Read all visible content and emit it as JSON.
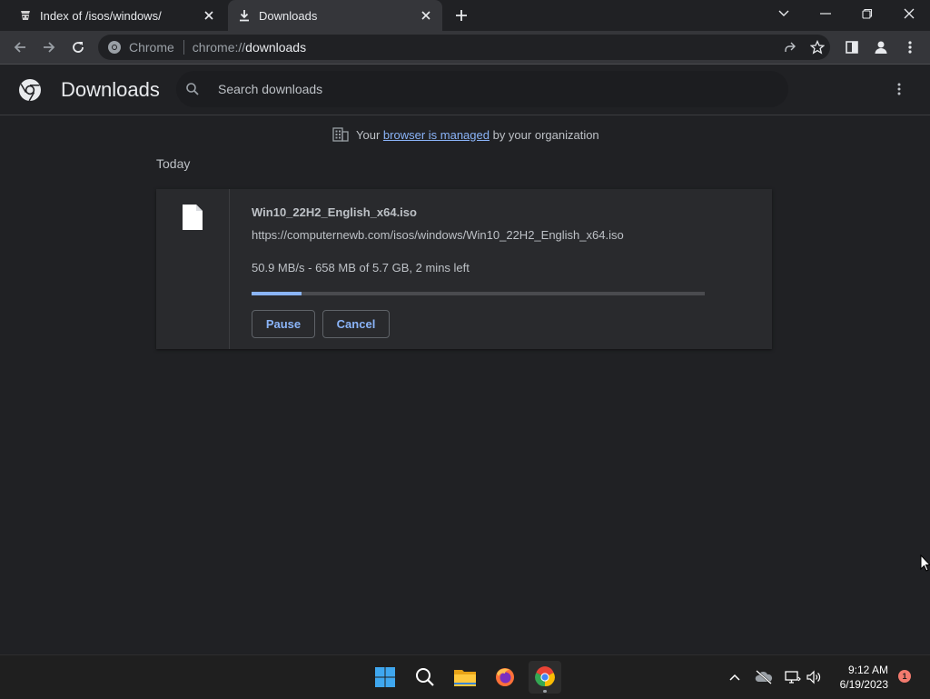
{
  "tabs": [
    {
      "title": "Index of /isos/windows/",
      "icon": "site-icon",
      "active": false
    },
    {
      "title": "Downloads",
      "icon": "download-icon",
      "active": true
    }
  ],
  "omnibox": {
    "site_name": "Chrome",
    "url_scheme": "chrome://",
    "url_host": "downloads"
  },
  "downloads_page": {
    "title": "Downloads",
    "search_placeholder": "Search downloads",
    "managed_prefix": "Your",
    "managed_link": "browser is managed",
    "managed_suffix": "by your organization",
    "date_group": "Today",
    "item": {
      "filename": "Win10_22H2_English_x64.iso",
      "url": "https://computernewb.com/isos/windows/Win10_22H2_English_x64.iso",
      "status": "50.9 MB/s - 658 MB of 5.7 GB, 2 mins left",
      "progress_fraction": 0.11,
      "pause_label": "Pause",
      "cancel_label": "Cancel"
    }
  },
  "taskbar": {
    "apps": [
      "windows-start",
      "search",
      "file-explorer",
      "firefox",
      "chrome"
    ],
    "time": "9:12 AM",
    "date": "6/19/2023",
    "notification_count": "1"
  },
  "colors": {
    "background": "#202124",
    "toolbar": "#35363a",
    "accent": "#8ab4f8",
    "card": "#292a2d"
  }
}
